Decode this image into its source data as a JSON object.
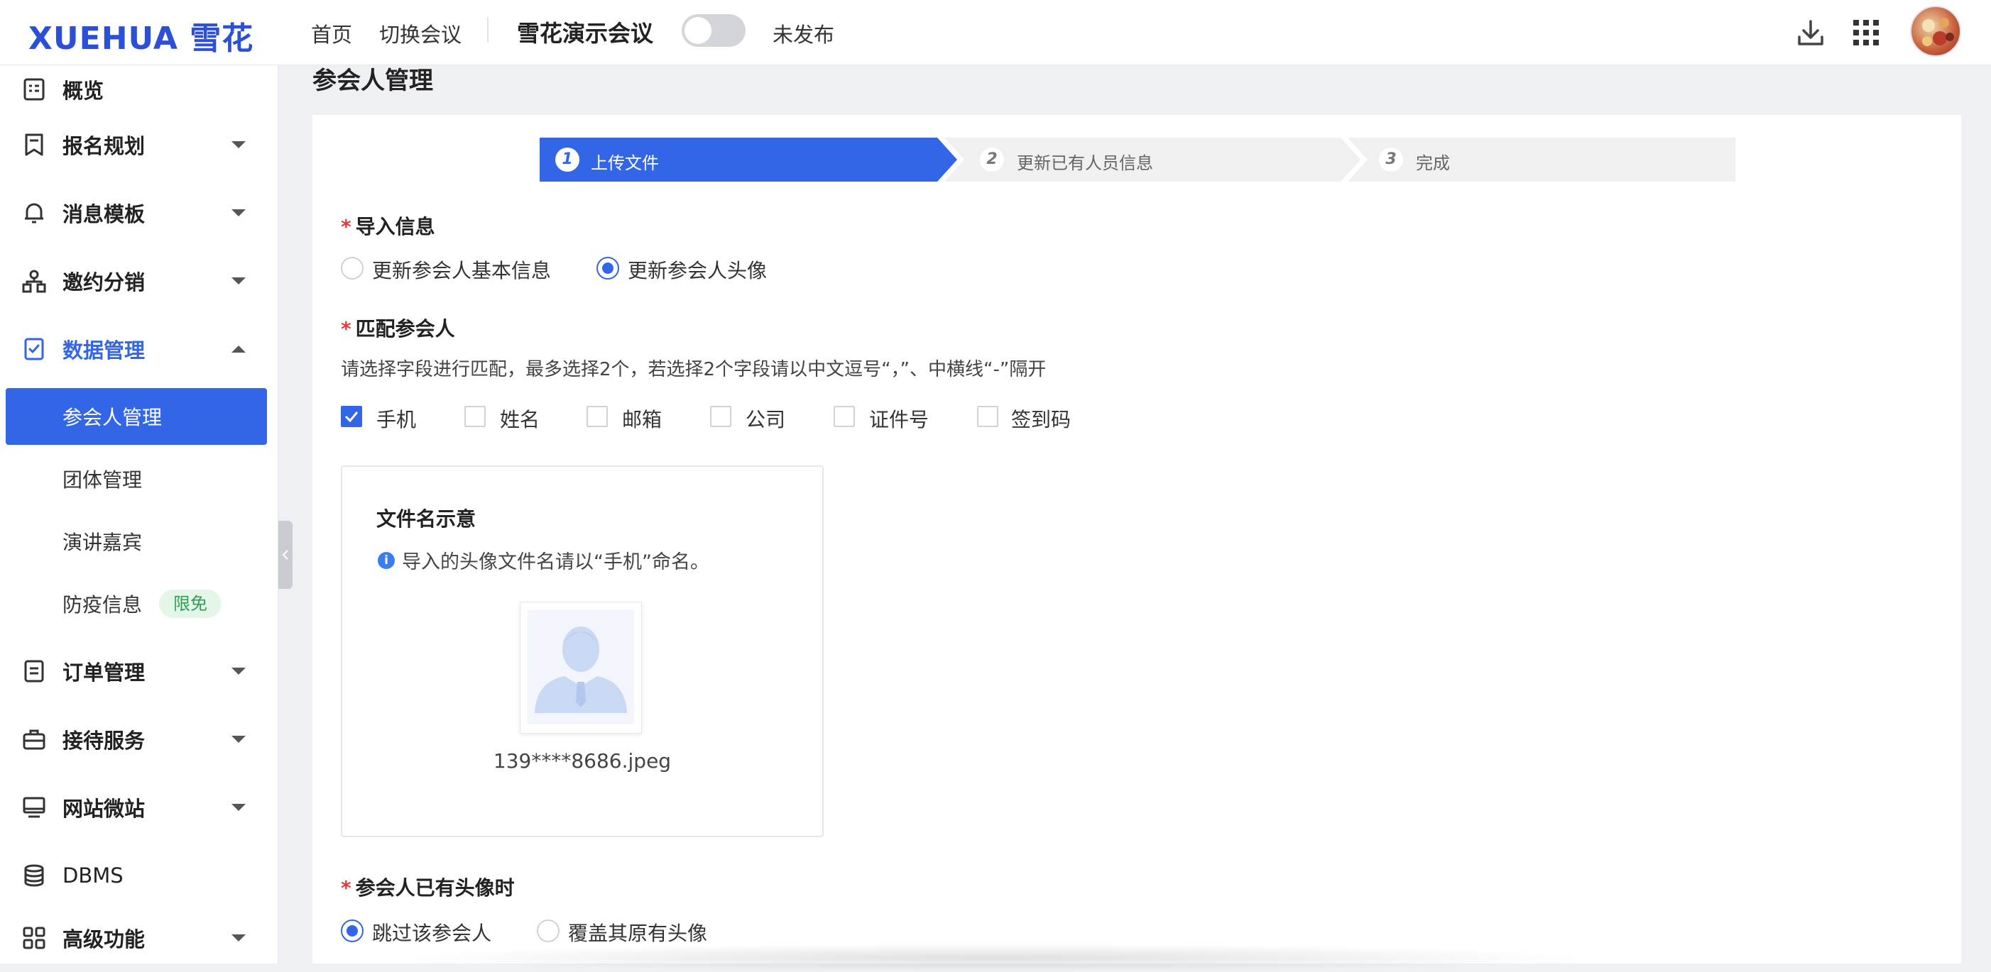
{
  "header": {
    "logo": "XUEHUA 雪花",
    "nav": [
      "首页",
      "切换会议"
    ],
    "conference_title": "雪花演示会议",
    "publish_status": "未发布",
    "icons": [
      "download-icon",
      "apps-grid-icon",
      "user-avatar"
    ]
  },
  "sidebar": {
    "items": [
      {
        "label": "概览",
        "icon": "overview-icon"
      },
      {
        "label": "报名规划",
        "icon": "bookmark-icon"
      },
      {
        "label": "消息模板",
        "icon": "bell-icon"
      },
      {
        "label": "邀约分销",
        "icon": "share-nodes-icon"
      },
      {
        "label": "数据管理",
        "icon": "data-icon",
        "expanded": true
      },
      {
        "label": "订单管理",
        "icon": "order-icon"
      },
      {
        "label": "接待服务",
        "icon": "briefcase-icon"
      },
      {
        "label": "网站微站",
        "icon": "monitor-icon"
      },
      {
        "label": "DBMS",
        "icon": "database-icon"
      },
      {
        "label": "高级功能",
        "icon": "grid-icon"
      }
    ],
    "sub_items": [
      {
        "label": "参会人管理",
        "selected": true
      },
      {
        "label": "团体管理"
      },
      {
        "label": "演讲嘉宾"
      },
      {
        "label": "防疫信息",
        "badge": "限免"
      }
    ]
  },
  "page": {
    "title": "参会人管理",
    "steps": [
      {
        "num": "1",
        "label": "上传文件",
        "active": true
      },
      {
        "num": "2",
        "label": "更新已有人员信息"
      },
      {
        "num": "3",
        "label": "完成"
      }
    ],
    "import_info": {
      "label": "导入信息",
      "options": [
        {
          "label": "更新参会人基本信息",
          "selected": false
        },
        {
          "label": "更新参会人头像",
          "selected": true
        }
      ]
    },
    "match": {
      "label": "匹配参会人",
      "hint": "请选择字段进行匹配，最多选择2个，若选择2个字段请以中文逗号“，”、中横线“-”隔开",
      "fields": [
        {
          "label": "手机",
          "checked": true
        },
        {
          "label": "姓名",
          "checked": false
        },
        {
          "label": "邮箱",
          "checked": false
        },
        {
          "label": "公司",
          "checked": false
        },
        {
          "label": "证件号",
          "checked": false
        },
        {
          "label": "签到码",
          "checked": false
        }
      ]
    },
    "sample": {
      "title": "文件名示意",
      "note": "导入的头像文件名请以“手机”命名。",
      "filename": "139****8686.jpeg"
    },
    "existing_avatar": {
      "label": "参会人已有头像时",
      "options": [
        {
          "label": "跳过该参会人",
          "selected": true
        },
        {
          "label": "覆盖其原有头像",
          "selected": false
        }
      ]
    }
  },
  "colors": {
    "primary": "#3366e6",
    "required": "#e23c3c",
    "badge_green": "#2ea052"
  }
}
